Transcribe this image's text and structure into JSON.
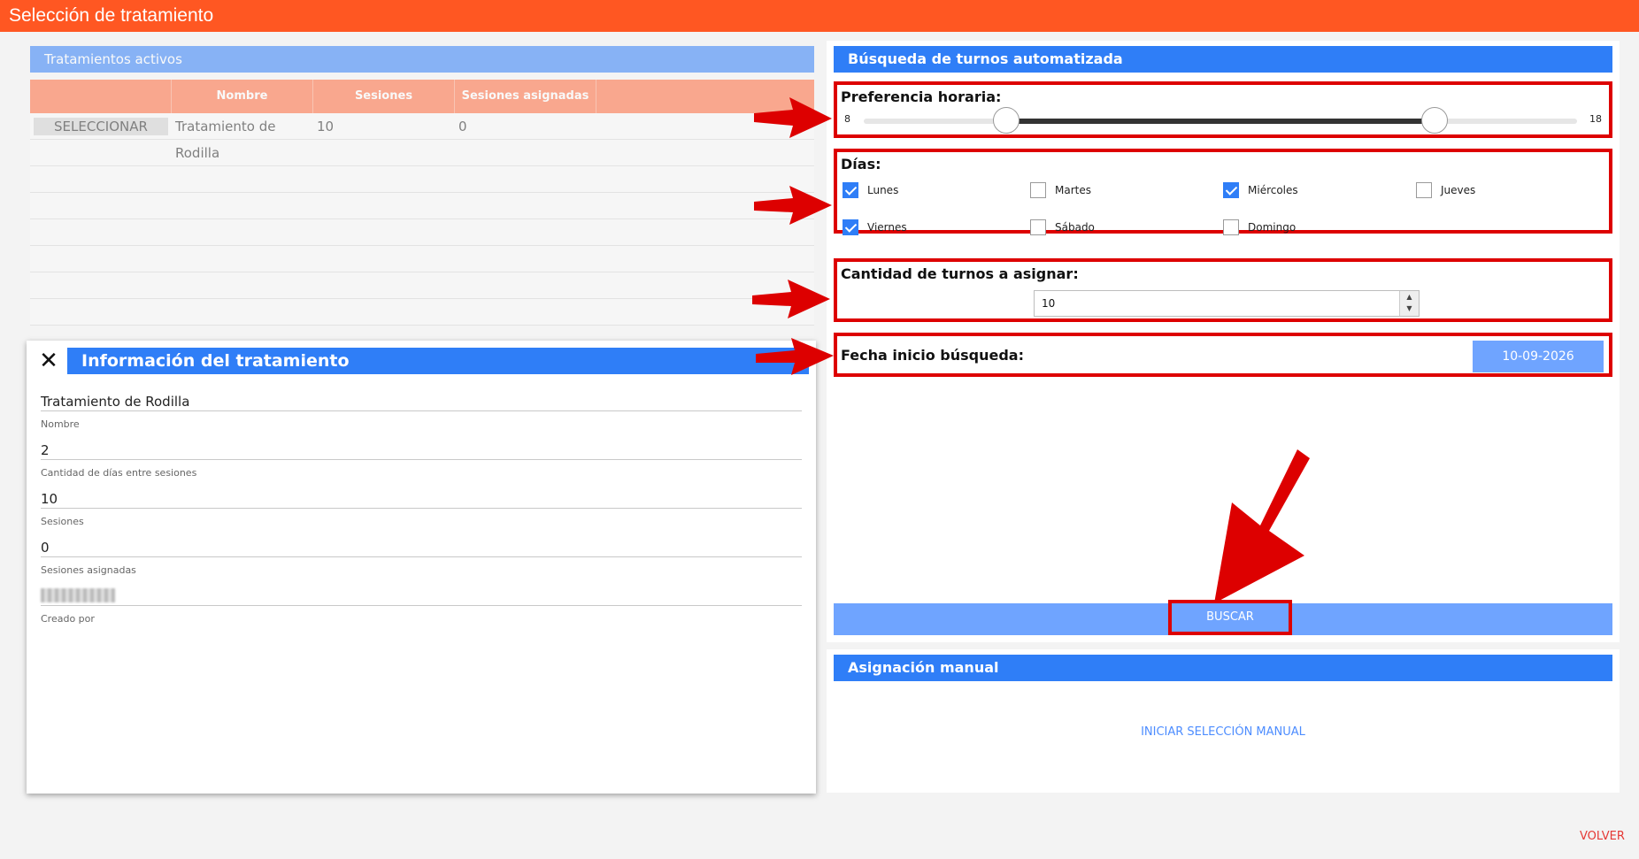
{
  "window": {
    "title": "Selección de tratamiento"
  },
  "active_treatments": {
    "title": "Tratamientos activos",
    "columns": [
      "",
      "Nombre",
      "Sesiones",
      "Sesiones asignadas"
    ],
    "rows": [
      {
        "action": "SELECCIONAR",
        "nombre": "Tratamiento de Rodilla",
        "sesiones": "10",
        "asignadas": "0"
      }
    ]
  },
  "info_dialog": {
    "title": "Información del tratamiento",
    "close_icon": "close-icon",
    "fields": [
      {
        "value": "Tratamiento de Rodilla",
        "label": "Nombre"
      },
      {
        "value": "2",
        "label": "Cantidad de días entre sesiones"
      },
      {
        "value": "10",
        "label": "Sesiones"
      },
      {
        "value": "0",
        "label": "Sesiones asignadas"
      },
      {
        "value": "",
        "label": "Creado por"
      }
    ]
  },
  "auto_search": {
    "title": "Búsqueda de turnos automatizada",
    "time_pref": {
      "label": "Preferencia horaria:",
      "min": "8",
      "max": "18",
      "range": [
        10,
        16
      ]
    },
    "days": {
      "label": "Días:",
      "items": [
        {
          "name": "Lunes",
          "checked": true
        },
        {
          "name": "Martes",
          "checked": false
        },
        {
          "name": "Miércoles",
          "checked": true
        },
        {
          "name": "Jueves",
          "checked": false
        },
        {
          "name": "Viernes",
          "checked": true
        },
        {
          "name": "Sábado",
          "checked": false
        },
        {
          "name": "Domingo",
          "checked": false
        }
      ]
    },
    "quantity": {
      "label": "Cantidad de turnos a asignar:",
      "value": "10"
    },
    "start_date": {
      "label": "Fecha inicio búsqueda:",
      "value": "10-09-2026"
    },
    "search_button": "BUSCAR"
  },
  "manual": {
    "title": "Asignación manual",
    "link": "INICIAR SELECCIÓN MANUAL"
  },
  "footer": {
    "back": "VOLVER"
  },
  "colors": {
    "accent": "#ff5722",
    "primary": "#2f7ef7",
    "highlight": "#dd0000"
  }
}
